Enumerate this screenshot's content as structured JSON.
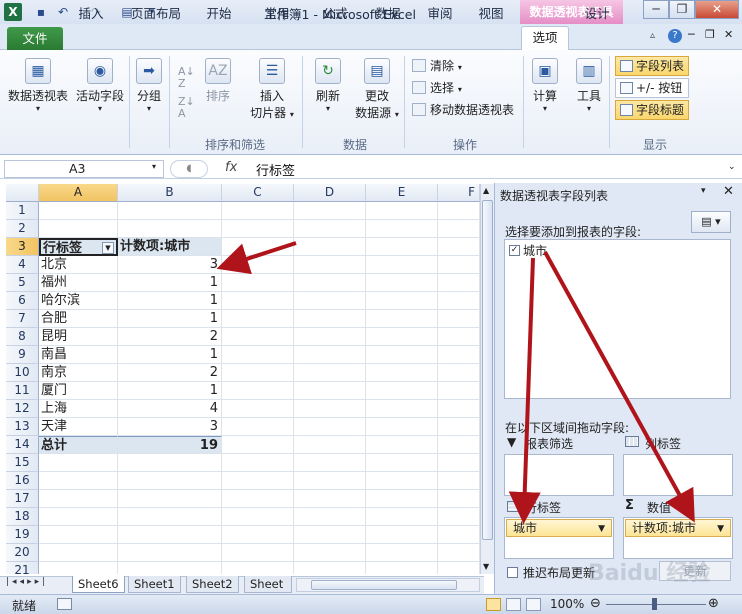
{
  "window": {
    "title": "工作簿1 - Microsoft Excel",
    "context_tab": "数据透视表工具"
  },
  "tabs": [
    "文件",
    "插入",
    "页面布局",
    "开始",
    "常用",
    "公式",
    "数据",
    "审阅",
    "视图",
    "选项",
    "设计"
  ],
  "ribbon": {
    "pivot_table": "数据透视表",
    "active_field": "活动字段",
    "group": "分组",
    "sort": "排序",
    "insert_slicer_1": "插入",
    "insert_slicer_2": "切片器",
    "refresh": "刷新",
    "change_source_1": "更改",
    "change_source_2": "数据源",
    "clear": "清除",
    "select": "选择",
    "move_pivot": "移动数据透视表",
    "calculations": "计算",
    "tools": "工具",
    "field_list": "字段列表",
    "plus_minus": "+/- 按钮",
    "field_headers": "字段标题",
    "group_sort_filter": "排序和筛选",
    "group_data": "数据",
    "group_actions": "操作",
    "group_show": "显示"
  },
  "formula_bar": {
    "name_box": "A3",
    "fx": "fx",
    "value": "行标签"
  },
  "columns": [
    "A",
    "B",
    "C",
    "D",
    "E",
    "F"
  ],
  "rows": [
    "1",
    "2",
    "3",
    "4",
    "5",
    "6",
    "7",
    "8",
    "9",
    "10",
    "11",
    "12",
    "13",
    "14",
    "15",
    "16",
    "17",
    "18",
    "19",
    "20",
    "21"
  ],
  "pivot": {
    "row_header": "行标签",
    "value_header": "计数项:城市",
    "items": [
      {
        "label": "北京",
        "value": "3"
      },
      {
        "label": "福州",
        "value": "1"
      },
      {
        "label": "哈尔滨",
        "value": "1"
      },
      {
        "label": "合肥",
        "value": "1"
      },
      {
        "label": "昆明",
        "value": "2"
      },
      {
        "label": "南昌",
        "value": "1"
      },
      {
        "label": "南京",
        "value": "2"
      },
      {
        "label": "厦门",
        "value": "1"
      },
      {
        "label": "上海",
        "value": "4"
      },
      {
        "label": "天津",
        "value": "3"
      }
    ],
    "total_label": "总计",
    "total_value": "19"
  },
  "sheet_tabs": [
    "Sheet6",
    "Sheet1",
    "Sheet2",
    "Sheet"
  ],
  "status": {
    "ready": "就绪",
    "zoom": "100%"
  },
  "field_pane": {
    "title": "数据透视表字段列表",
    "choose_label": "选择要添加到报表的字段:",
    "field": "城市",
    "drag_label": "在以下区域间拖动字段:",
    "report_filter": "报表筛选",
    "column_labels": "列标签",
    "row_labels": "行标签",
    "values": "数值",
    "row_item": "城市",
    "value_item": "计数项:城市",
    "defer": "推迟布局更新",
    "update": "更新"
  },
  "colors": {
    "arrow": "#b0141b",
    "file_tab": "#2b7a33",
    "pivot_header": "#dce6f1"
  }
}
